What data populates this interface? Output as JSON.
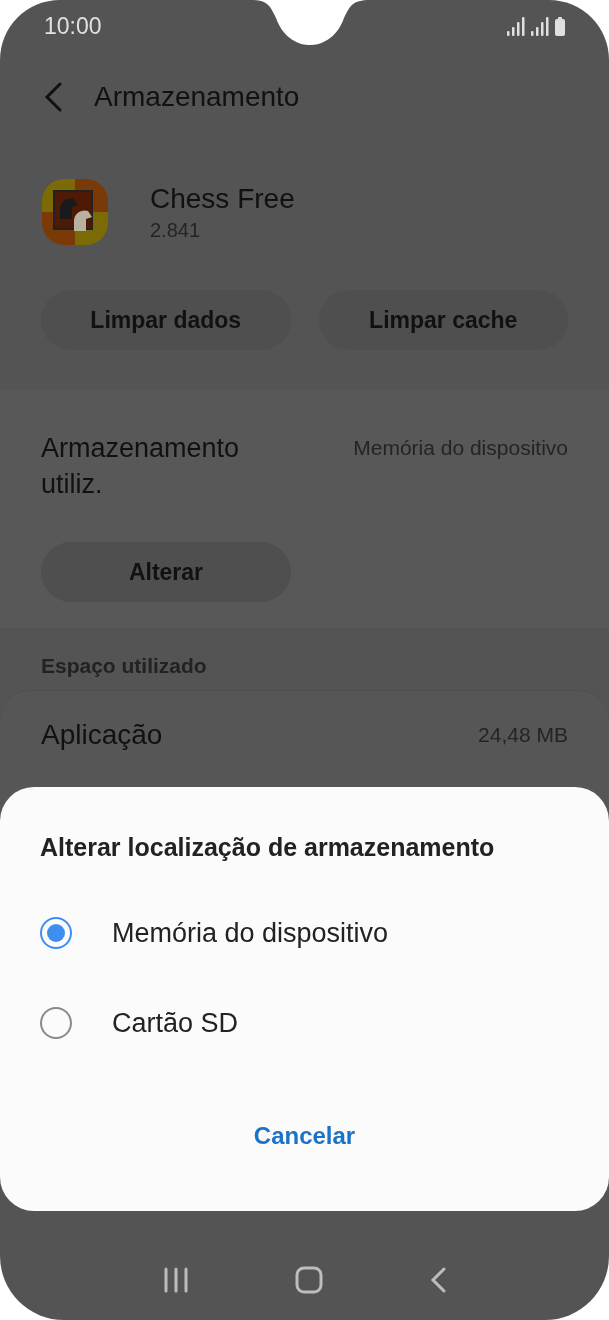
{
  "status_bar": {
    "time": "10:00"
  },
  "header": {
    "title": "Armazenamento"
  },
  "app": {
    "name": "Chess Free",
    "version": "2.841"
  },
  "actions": [
    "Limpar dados",
    "Limpar cache"
  ],
  "storage": {
    "label": "Armazenamento utiliz.",
    "value": "Memória do dispositivo",
    "button": "Alterar"
  },
  "space_used": {
    "heading": "Espaço utilizado",
    "rows": [
      {
        "label": "Aplicação",
        "value": "24,48 MB"
      }
    ]
  },
  "dialog": {
    "title": "Alterar localização de armazenamento",
    "options": [
      {
        "label": "Memória do dispositivo",
        "selected": true
      },
      {
        "label": "Cartão SD",
        "selected": false
      }
    ],
    "button": "Cancelar"
  }
}
